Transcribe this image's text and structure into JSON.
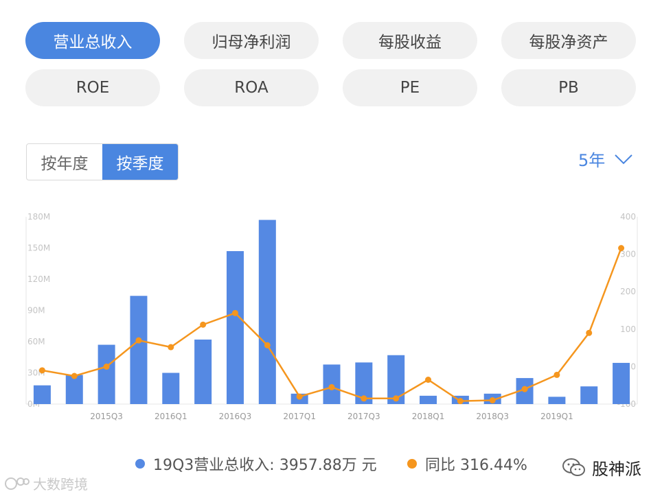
{
  "metric_tabs": [
    "营业总收入",
    "归母净利润",
    "每股收益",
    "每股净资产",
    "ROE",
    "ROA",
    "PE",
    "PB"
  ],
  "period_toggle": {
    "annual": "按年度",
    "quarterly": "按季度"
  },
  "range_select": "5年",
  "colors": {
    "accent": "#4a86e0",
    "bar": "#5589e3",
    "line": "#f5961e"
  },
  "chart_data": {
    "type": "bar",
    "categories": [
      "2015Q1",
      "2015Q2",
      "2015Q3",
      "2015Q4",
      "2016Q1",
      "2016Q2",
      "2016Q3",
      "2016Q4",
      "2017Q1",
      "2017Q2",
      "2017Q3",
      "2017Q4",
      "2018Q1",
      "2018Q2",
      "2018Q3",
      "2018Q4",
      "2019Q1",
      "2019Q2",
      "2019Q3"
    ],
    "x_tick_labels": [
      "2015Q3",
      "2016Q1",
      "2016Q3",
      "2017Q1",
      "2017Q3",
      "2018Q1",
      "2018Q3",
      "2019Q1"
    ],
    "series": [
      {
        "name": "营业总收入",
        "type": "bar",
        "axis": "left",
        "values": [
          18,
          28,
          57,
          104,
          30,
          62,
          147,
          177,
          10,
          38,
          40,
          47,
          8,
          8,
          10,
          25,
          7,
          17,
          39.6
        ]
      },
      {
        "name": "同比",
        "type": "line",
        "axis": "right",
        "values": [
          -10,
          -25,
          0,
          70,
          52,
          112,
          143,
          57,
          -80,
          -55,
          -85,
          -85,
          -35,
          -92,
          -90,
          -60,
          -22,
          90,
          316.44
        ]
      }
    ],
    "left_axis": {
      "ticks": [
        "0M",
        "30M",
        "60M",
        "90M",
        "120M",
        "150M",
        "180M"
      ],
      "ylim": [
        0,
        180
      ]
    },
    "right_axis": {
      "ticks": [
        "-100",
        "0",
        "100",
        "200",
        "300",
        "400"
      ],
      "ylim": [
        -100,
        400
      ]
    },
    "legend": {
      "revenue": "19Q3营业总收入: 3957.88万 元",
      "yoy": "同比 316.44%"
    }
  },
  "watermarks": {
    "left": "大数跨境",
    "right": "股神派"
  }
}
